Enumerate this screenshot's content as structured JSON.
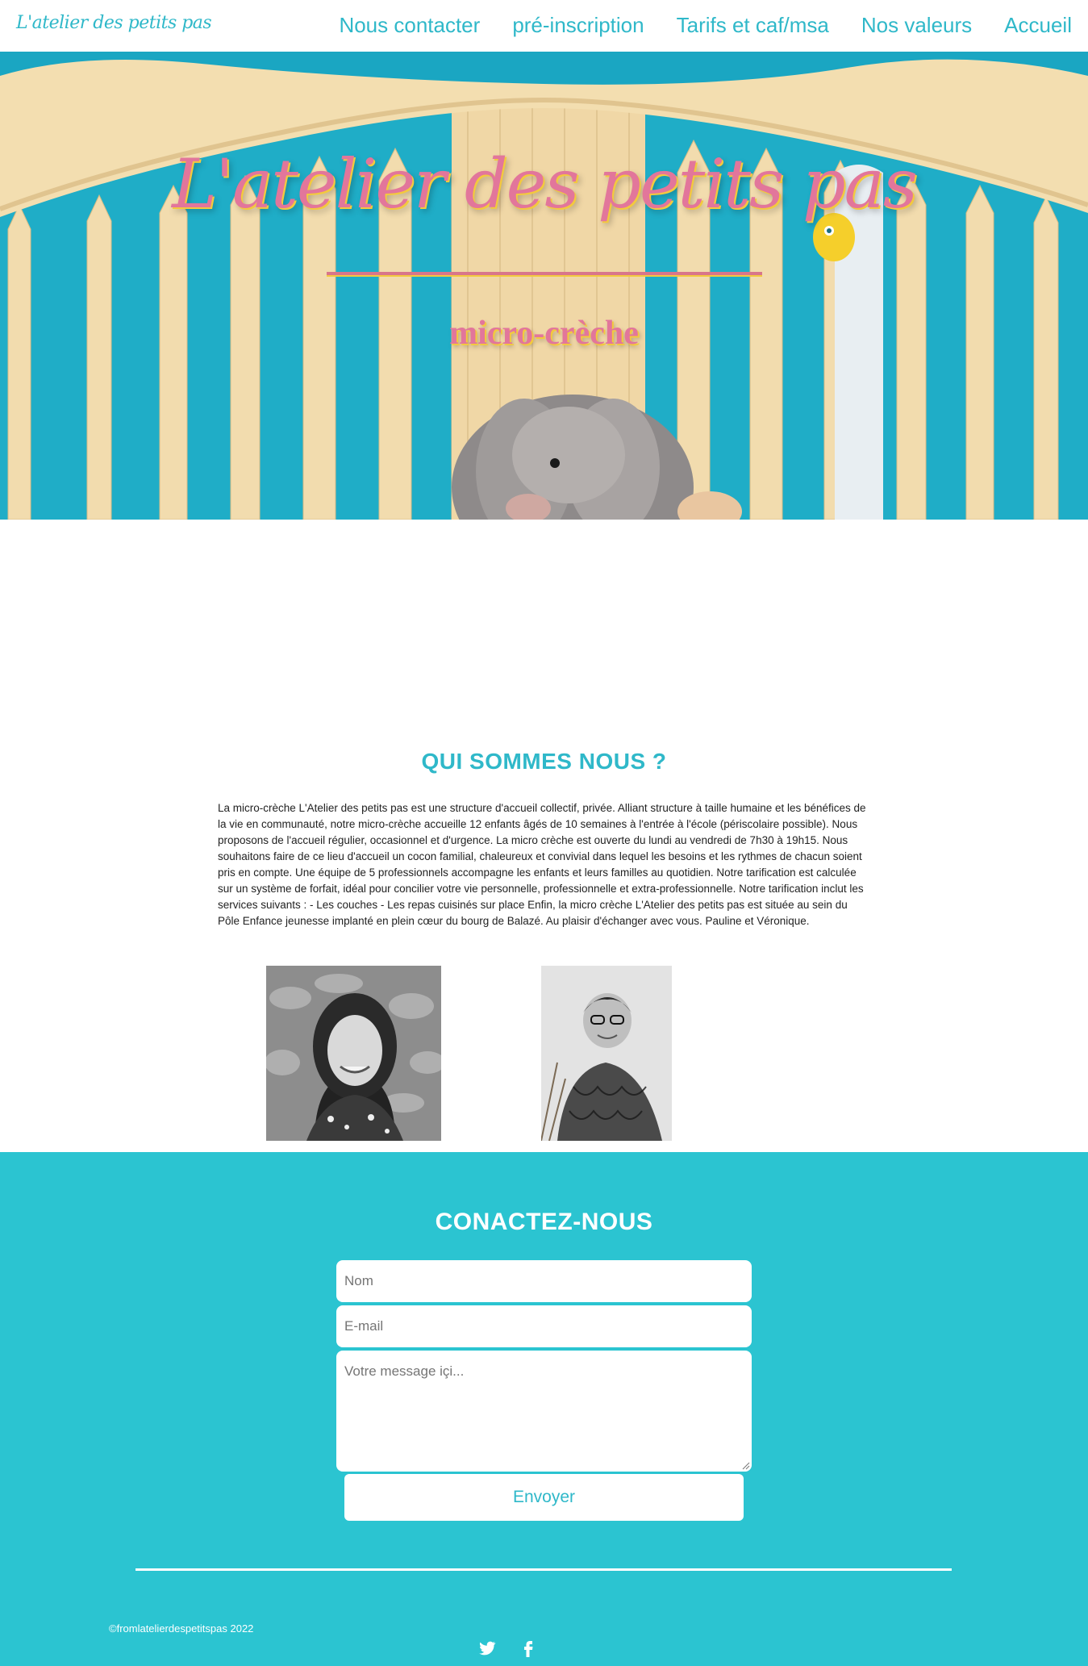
{
  "nav": {
    "brand": "L'atelier des petits pas",
    "items": [
      {
        "label": "Nous contacter"
      },
      {
        "label": "pré-inscription"
      },
      {
        "label": "Tarifs et caf/msa"
      },
      {
        "label": "Nos valeurs"
      },
      {
        "label": "Accueil"
      }
    ]
  },
  "hero": {
    "title": "L'atelier des petits pas",
    "subtitle": "micro-crèche"
  },
  "about": {
    "title": "QUI SOMMES NOUS ?",
    "text": "La micro-crèche L'Atelier des petits pas est une structure d'accueil collectif, privée. Alliant structure à taille humaine et les bénéfices de la vie en communauté, notre micro-crèche accueille 12 enfants âgés de 10 semaines à l'entrée à l'école (périscolaire possible). Nous proposons de l'accueil régulier, occasionnel et d'urgence. La micro crèche est ouverte du lundi au vendredi de 7h30 à 19h15. Nous souhaitons faire de ce lieu d'accueil un cocon familial, chaleureux et convivial dans lequel les besoins et les rythmes de chacun soient pris en compte. Une équipe de 5 professionnels accompagne les enfants et leurs familles au quotidien. Notre tarification est calculée sur un système de forfait, idéal pour concilier votre vie personnelle, professionnelle et extra-professionnelle. Notre tarification inclut les services suivants : - Les couches - Les repas cuisinés sur place Enfin, la micro crèche L'Atelier des petits pas est située au sein du Pôle Enfance jeunesse implanté en plein cœur du bourg de Balazé. Au plaisir d'échanger avec vous. Pauline et Véronique."
  },
  "contact": {
    "title": "CONACTEZ-NOUS",
    "name_placeholder": "Nom",
    "email_placeholder": "E-mail",
    "message_placeholder": "Votre message içi...",
    "submit_label": "Envoyer"
  },
  "footer": {
    "copyright": "©fromlatelierdespetitspas 2022",
    "social": [
      {
        "icon": "twitter-icon"
      },
      {
        "icon": "facebook-icon"
      }
    ]
  },
  "colors": {
    "accent": "#2fb8c9",
    "contact_bg": "#2bc4d1",
    "title_pink": "#e2769b",
    "title_shadow_yellow": "#f3c93e"
  }
}
